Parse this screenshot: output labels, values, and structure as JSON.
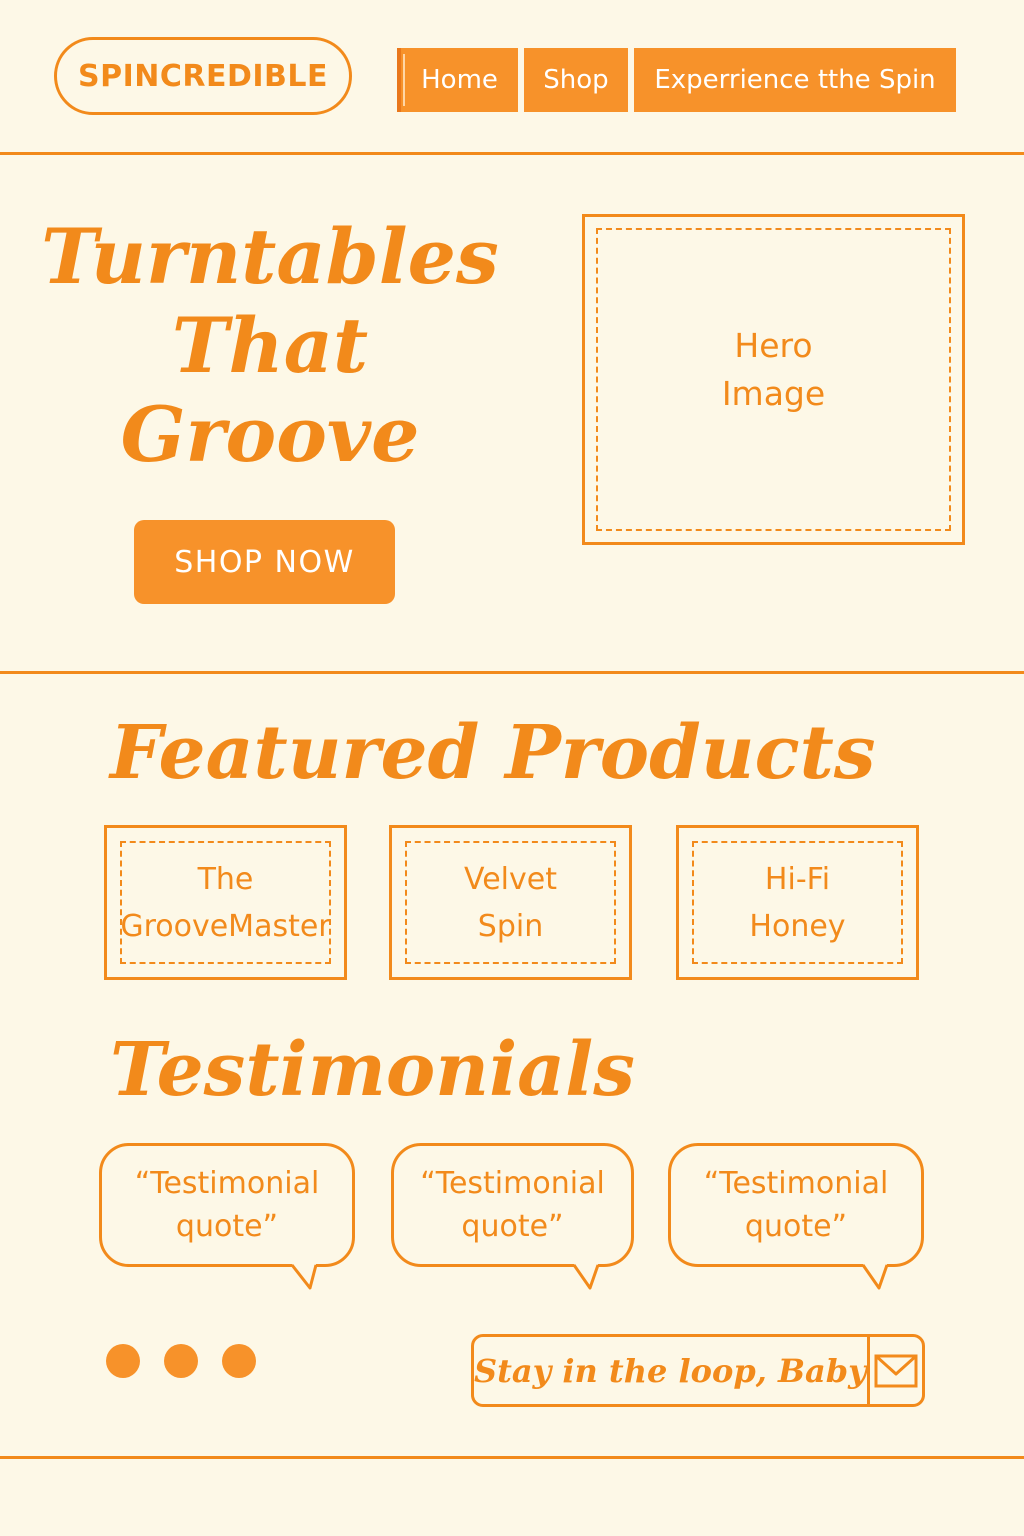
{
  "header": {
    "logo": "SPINCREDIBLE",
    "nav": [
      {
        "label": "Home"
      },
      {
        "label": "Shop"
      },
      {
        "label": "Experrience tthe Spin"
      }
    ]
  },
  "hero": {
    "title_lines": [
      "Turntables",
      "That",
      "Groove"
    ],
    "cta_label": "SHOP NOW",
    "image_placeholder_lines": [
      "Hero",
      "Image"
    ]
  },
  "featured": {
    "title": "Featured Products",
    "products": [
      {
        "lines": [
          "The",
          "GrooveMaster"
        ]
      },
      {
        "lines": [
          "Velvet",
          "Spin"
        ]
      },
      {
        "lines": [
          "Hi-Fi",
          "Honey"
        ]
      }
    ]
  },
  "testimonials": {
    "title": "Testimonials",
    "items": [
      {
        "lines": [
          "“Testimonial",
          "quote”"
        ]
      },
      {
        "lines": [
          "“Testimonial",
          "quote”"
        ]
      },
      {
        "lines": [
          "“Testimonial",
          "quote”"
        ]
      }
    ]
  },
  "footer": {
    "dots_count": 3,
    "newsletter_text": "Stay in the loop, Baby",
    "newsletter_icon": "envelope-icon"
  },
  "colors": {
    "background": "#fdf8e7",
    "accent": "#f28a1b",
    "button_fill": "#f7922a",
    "button_text": "#ffffff"
  }
}
